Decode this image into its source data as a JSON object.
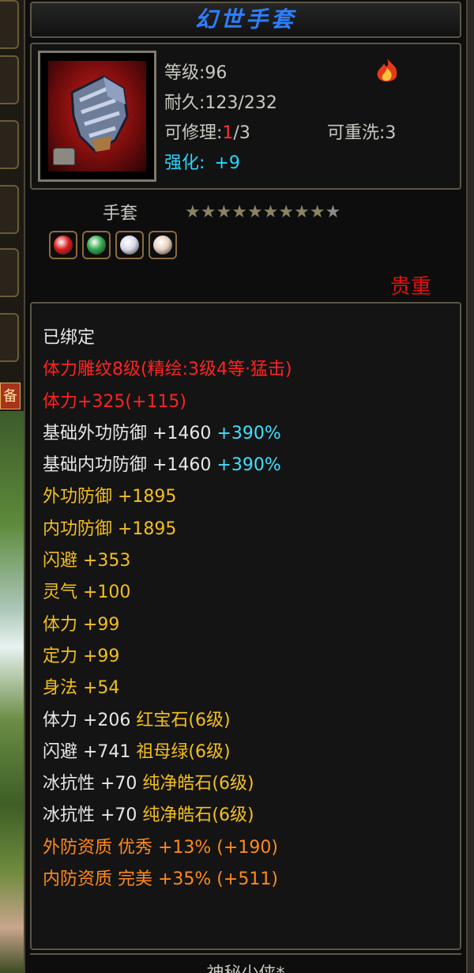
{
  "item": {
    "name": "幻世手套",
    "level_label": "等级:96",
    "durability_label": "耐久:",
    "durability_value": "123/232",
    "repair_label": "可修理:",
    "repair_used": "1",
    "repair_total": "/3",
    "rewash_label": "可重洗:3",
    "enhance_label": "强化:",
    "enhance_value": "+9",
    "type": "手套",
    "stars_filled": 9,
    "stars_total": 10,
    "quality": "贵重"
  },
  "attributes": [
    {
      "parts": [
        {
          "t": "已绑定",
          "c": "white"
        }
      ]
    },
    {
      "parts": [
        {
          "t": "体力雕纹8级(精绘:3级4等·猛击)",
          "c": "red"
        }
      ]
    },
    {
      "parts": [
        {
          "t": "体力+325(+115)",
          "c": "red"
        }
      ]
    },
    {
      "parts": [
        {
          "t": "基础外功防御 +1460 ",
          "c": "white"
        },
        {
          "t": "+390%",
          "c": "cyan"
        }
      ]
    },
    {
      "parts": [
        {
          "t": "基础内功防御 +1460 ",
          "c": "white"
        },
        {
          "t": "+390%",
          "c": "cyan"
        }
      ]
    },
    {
      "parts": [
        {
          "t": "外功防御 +1895",
          "c": "gold"
        }
      ]
    },
    {
      "parts": [
        {
          "t": "内功防御 +1895",
          "c": "gold"
        }
      ]
    },
    {
      "parts": [
        {
          "t": "闪避 +353",
          "c": "gold"
        }
      ]
    },
    {
      "parts": [
        {
          "t": "灵气 +100",
          "c": "gold"
        }
      ]
    },
    {
      "parts": [
        {
          "t": "体力 +99",
          "c": "gold"
        }
      ]
    },
    {
      "parts": [
        {
          "t": "定力 +99",
          "c": "gold"
        }
      ]
    },
    {
      "parts": [
        {
          "t": "身法 +54",
          "c": "gold"
        }
      ]
    },
    {
      "parts": [
        {
          "t": "体力 +206 ",
          "c": "white"
        },
        {
          "t": "红宝石(6级)",
          "c": "gold"
        }
      ]
    },
    {
      "parts": [
        {
          "t": "闪避 +741 ",
          "c": "white"
        },
        {
          "t": "祖母绿(6级)",
          "c": "gold"
        }
      ]
    },
    {
      "parts": [
        {
          "t": "冰抗性 +70 ",
          "c": "white"
        },
        {
          "t": "纯净皓石(6级)",
          "c": "gold"
        }
      ]
    },
    {
      "parts": [
        {
          "t": "冰抗性 +70 ",
          "c": "white"
        },
        {
          "t": "纯净皓石(6级)",
          "c": "gold"
        }
      ]
    },
    {
      "parts": [
        {
          "t": "外防资质  优秀 +13% (+190)",
          "c": "orange"
        }
      ]
    },
    {
      "parts": [
        {
          "t": "内防资质  完美 +35% (+511)",
          "c": "orange"
        }
      ]
    }
  ],
  "footer": "神秘少侠*",
  "side_tab": "备",
  "gem_slots": [
    {
      "icon": "red-gem-icon",
      "color": "#d81c1c"
    },
    {
      "icon": "green-gem-icon",
      "color": "#2fa84a"
    },
    {
      "icon": "white-gem-icon",
      "color": "#d9d9e8"
    },
    {
      "icon": "white-gem-icon",
      "color": "#e6d0c0"
    }
  ]
}
